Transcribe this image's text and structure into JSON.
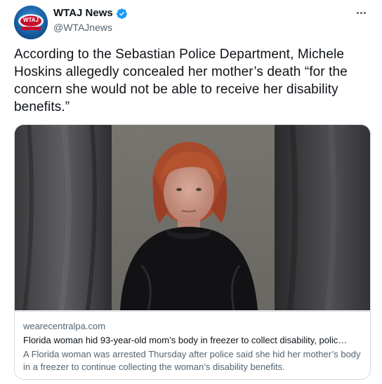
{
  "author": {
    "display_name": "WTAJ News",
    "handle": "@WTAJnews",
    "verified": true,
    "avatar_text": "WTAJ"
  },
  "tweet": {
    "text": "According to the Sebastian Police Department, Michele Hoskins allegedly concealed her mother’s death “for the concern she would not be able to receive her disability benefits.”"
  },
  "link_card": {
    "domain": "wearecentralpa.com",
    "title": "Florida woman hid 93-year-old mom’s body in freezer to collect disability, polic…",
    "description": "A Florida woman was arrested Thursday after police said she hid her mother’s body in a freezer to continue collecting the woman’s disability benefits."
  },
  "icons": {
    "verified": "verified-badge-icon",
    "more": "more-options-icon"
  },
  "colors": {
    "verified_blue": "#1d9bf0",
    "text_primary": "#0f1419",
    "text_secondary": "#536471",
    "border": "#cfd9de",
    "avatar_blue": "#1d6fb8"
  }
}
